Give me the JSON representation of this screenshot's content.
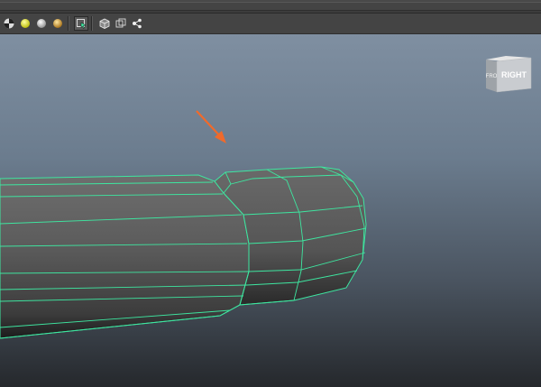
{
  "toolbar": {
    "buttons": [
      {
        "name": "checker-render-icon"
      },
      {
        "name": "ambient-light-icon"
      },
      {
        "name": "default-light-icon"
      },
      {
        "name": "lighting-all-icon"
      },
      {
        "name": "xray-select-icon"
      },
      {
        "name": "isolate-select-icon"
      },
      {
        "name": "wireframe-on-shaded-icon"
      },
      {
        "name": "node-share-icon"
      }
    ]
  },
  "view_cube": {
    "front_label": "FRO",
    "right_label": "RIGHT"
  },
  "colors": {
    "wireframe": "#3ee6a0",
    "arrow": "#f06a2b",
    "mesh_face": "#5a5a5a"
  }
}
